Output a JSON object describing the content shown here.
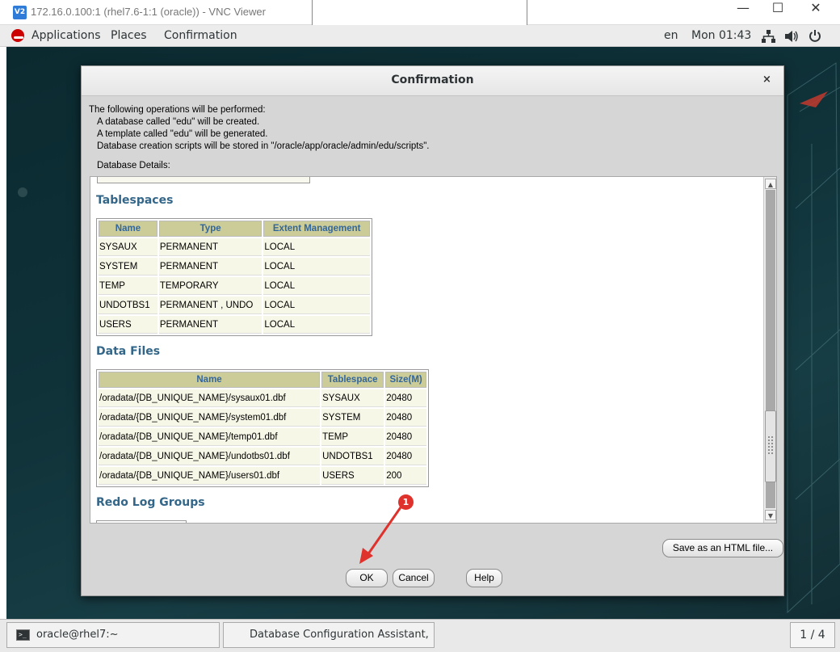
{
  "vnc": {
    "title": "172.16.0.100:1 (rhel7.6-1:1 (oracle)) - VNC Viewer",
    "logo": "V2",
    "controls": {
      "minimize": "—",
      "maximize": "☐",
      "close": "✕"
    }
  },
  "topbar": {
    "menus": [
      "Applications",
      "Places",
      "Confirmation"
    ],
    "language": "en",
    "clock": "Mon 01:43",
    "icons": [
      "network-icon",
      "volume-icon",
      "power-icon"
    ]
  },
  "dialog": {
    "title": "Confirmation",
    "close": "×",
    "summary": {
      "heading": "The following operations will be performed:",
      "lines": [
        "A database called \"edu\" will be created.",
        "A template called \"edu\" will be generated.",
        "Database creation scripts will be stored in \"/oracle/app/oracle/admin/edu/scripts\"."
      ]
    },
    "details_label": "Database Details:",
    "tablespaces": {
      "title": "Tablespaces",
      "headers": [
        "Name",
        "Type",
        "Extent Management"
      ],
      "rows": [
        [
          "SYSAUX",
          "PERMANENT",
          "LOCAL"
        ],
        [
          "SYSTEM",
          "PERMANENT",
          "LOCAL"
        ],
        [
          "TEMP",
          "TEMPORARY",
          "LOCAL"
        ],
        [
          "UNDOTBS1",
          "PERMANENT , UNDO",
          "LOCAL"
        ],
        [
          "USERS",
          "PERMANENT",
          "LOCAL"
        ]
      ]
    },
    "datafiles": {
      "title": "Data Files",
      "headers": [
        "Name",
        "Tablespace",
        "Size(M)"
      ],
      "rows": [
        [
          "/oradata/{DB_UNIQUE_NAME}/sysaux01.dbf",
          "SYSAUX",
          "20480"
        ],
        [
          "/oradata/{DB_UNIQUE_NAME}/system01.dbf",
          "SYSTEM",
          "20480"
        ],
        [
          "/oradata/{DB_UNIQUE_NAME}/temp01.dbf",
          "TEMP",
          "20480"
        ],
        [
          "/oradata/{DB_UNIQUE_NAME}/undotbs01.dbf",
          "UNDOTBS1",
          "20480"
        ],
        [
          "/oradata/{DB_UNIQUE_NAME}/users01.dbf",
          "USERS",
          "200"
        ]
      ]
    },
    "redo": {
      "title": "Redo Log Groups"
    },
    "buttons": {
      "save_html": "Save as an HTML file...",
      "ok": "OK",
      "cancel": "Cancel",
      "help": "Help"
    }
  },
  "annotation": {
    "marker": "1",
    "color": "#e0322c"
  },
  "taskbar": {
    "items": [
      "oracle@rhel7:~",
      "Database Configuration Assistant, St..."
    ],
    "pager": "1 / 4"
  }
}
